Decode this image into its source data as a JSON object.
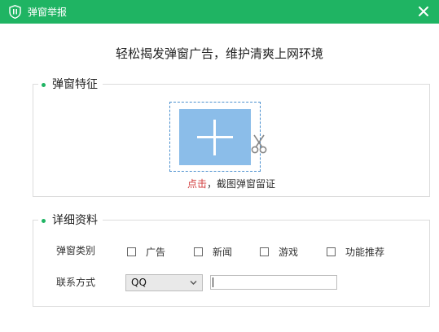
{
  "window": {
    "title": "弹窗举报",
    "accent": "#1fb463"
  },
  "headline": "轻松揭发弹窗广告，维护清爽上网环境",
  "features": {
    "legend": "弹窗特征",
    "hint_action": "点击",
    "hint_rest": "，截图弹窗留证"
  },
  "details": {
    "legend": "详细资料",
    "category_label": "弹窗类别",
    "categories": [
      {
        "label": "广告",
        "checked": false
      },
      {
        "label": "新闻",
        "checked": false
      },
      {
        "label": "游戏",
        "checked": false
      },
      {
        "label": "功能推荐",
        "checked": false
      }
    ],
    "contact_label": "联系方式",
    "contact_type": "QQ",
    "contact_value": ""
  }
}
